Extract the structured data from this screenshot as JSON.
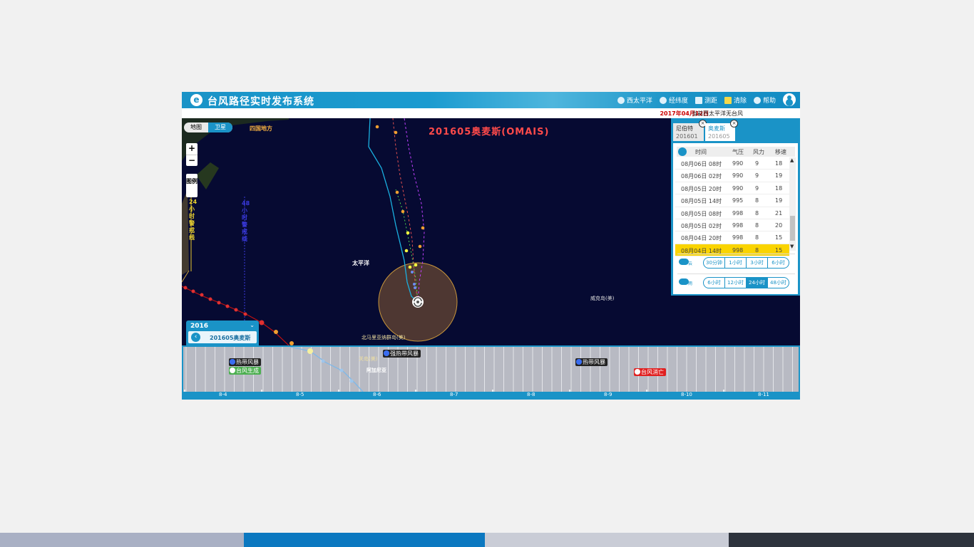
{
  "app": {
    "title": "台风路径实时发布系统",
    "toolbar": [
      {
        "label": "西太平洋",
        "icon": "globe-icon"
      },
      {
        "label": "经纬度",
        "icon": "grid-globe-icon"
      },
      {
        "label": "测距",
        "icon": "ruler-icon"
      },
      {
        "label": "清除",
        "icon": "broom-icon"
      },
      {
        "label": "帮助",
        "icon": "help-icon"
      }
    ]
  },
  "subbar": {
    "date": "2017年04月12日",
    "status": "当前西太平洋无台风"
  },
  "map": {
    "toggle": {
      "map": "地图",
      "satellite": "卫星"
    },
    "zoom_in": "+",
    "zoom_out": "−",
    "legend": "图例",
    "storm_title": "201605奥麦斯(OMAIS)",
    "labels": {
      "region": "四国地方",
      "warning24": "24小时警戒线",
      "warning48": "48小时警戒线",
      "ocean": "太平洋",
      "wake": "威克岛(美)",
      "mariana": "北马里亚纳群岛(美)",
      "guam": "关岛(美)",
      "guam2": "阿加尼亚"
    },
    "year_box": {
      "year": "2016",
      "storm": "201605奥麦斯"
    }
  },
  "panel": {
    "tabs": [
      {
        "name": "尼伯特",
        "code": "201601"
      },
      {
        "name": "奥麦斯",
        "code": "201605"
      }
    ],
    "headers": {
      "time": "时间",
      "pressure": "气压",
      "wind": "风力",
      "speed": "移速"
    },
    "rows": [
      {
        "time": "08月06日 08时",
        "pressure": "990",
        "wind": "9",
        "speed": "18"
      },
      {
        "time": "08月06日 02时",
        "pressure": "990",
        "wind": "9",
        "speed": "19"
      },
      {
        "time": "08月05日 20时",
        "pressure": "990",
        "wind": "9",
        "speed": "18"
      },
      {
        "time": "08月05日 14时",
        "pressure": "995",
        "wind": "8",
        "speed": "19"
      },
      {
        "time": "08月05日 08时",
        "pressure": "998",
        "wind": "8",
        "speed": "21"
      },
      {
        "time": "08月05日 02时",
        "pressure": "998",
        "wind": "8",
        "speed": "20"
      },
      {
        "time": "08月04日 20时",
        "pressure": "998",
        "wind": "8",
        "speed": "15"
      },
      {
        "time": "08月04日 14时",
        "pressure": "998",
        "wind": "8",
        "speed": "15"
      }
    ],
    "cloud_options": [
      "30分钟",
      "1小时",
      "3小时",
      "6小时"
    ],
    "rain_options": [
      "6小时",
      "12小时",
      "24小时",
      "48小时"
    ],
    "rain_selected": "24小时",
    "cloud_label": "云",
    "rain_label": "雨"
  },
  "timeline": {
    "dates": [
      "8-4",
      "8-5",
      "8-6",
      "8-7",
      "8-8",
      "8-9",
      "8-10",
      "8-11"
    ],
    "events": {
      "ts1": "热带风暴",
      "genesis": "台风生成",
      "sts": "强热带风暴",
      "ts2": "热带风暴",
      "dissipate": "台风消亡"
    }
  },
  "colors": {
    "accent": "#1a93c7",
    "map_bg": "#060a32",
    "highlight": "#fad400",
    "storm_title": "#ff4a4a"
  }
}
